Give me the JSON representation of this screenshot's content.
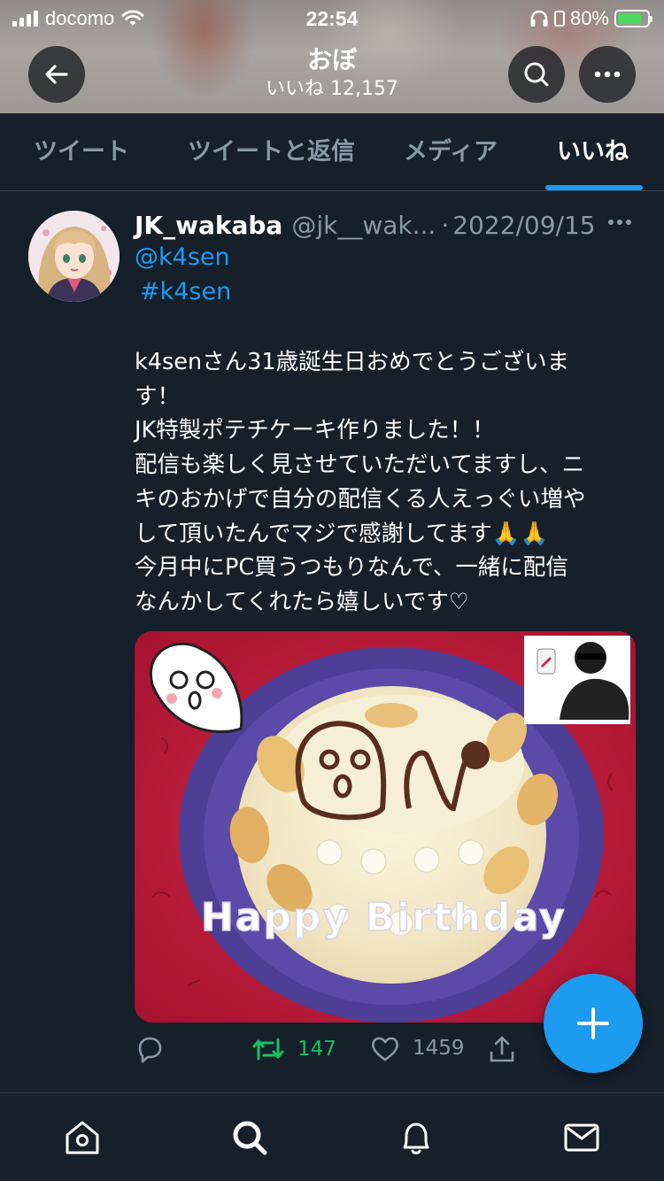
{
  "status_bar": {
    "carrier": "docomo",
    "time": "22:54",
    "battery": "80%"
  },
  "header": {
    "title": "おぼ",
    "subtitle": "いいね 12,157",
    "back_icon": "arrow-left-icon",
    "search_icon": "search-icon",
    "more_icon": "more-horizontal-icon"
  },
  "tabs": [
    {
      "label": "ツイート",
      "active": false
    },
    {
      "label": "ツイートと返信",
      "active": false
    },
    {
      "label": "メディア",
      "active": false
    },
    {
      "label": "いいね",
      "active": true
    }
  ],
  "tweet": {
    "display_name": "JK_wakaba",
    "handle": "@jk__wak...",
    "date": "2022/09/15",
    "mention": "@k4sen",
    "hashtag": "#k4sen",
    "body_lines": [
      "k4senさん31歳誕生日おめでとうございま",
      "す！",
      "JK特製ポテチケーキ作りました！！",
      "配信も楽しく見させていただいてますし、ニ",
      "キのおかげで自分の配信くる人えっぐい増や",
      "して頂いたんでマジで感謝してます🙏🙏",
      "今月中にPC買うつもりなんで、一緒に配信",
      "なんかしてくれたら嬉しいです♡"
    ],
    "media_caption": "Happy  Birthday",
    "retweet_count": "147",
    "like_count": "1459"
  },
  "colors": {
    "background": "#15202b",
    "accent": "#1d9bf0",
    "muted": "#8899a6",
    "retweet_green": "#17bf63"
  },
  "bottom_nav": [
    {
      "icon": "home-icon"
    },
    {
      "icon": "search-icon"
    },
    {
      "icon": "bell-icon"
    },
    {
      "icon": "mail-icon"
    }
  ]
}
